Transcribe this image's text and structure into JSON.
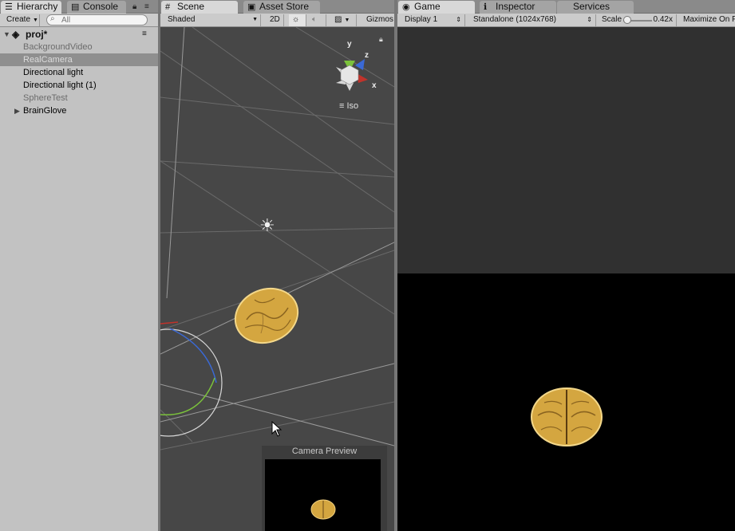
{
  "hierarchy": {
    "tabs": [
      {
        "label": "Hierarchy",
        "icon": "list-icon"
      },
      {
        "label": "Console",
        "icon": "console-icon"
      }
    ],
    "create_label": "Create",
    "search_placeholder": "All",
    "scene_name": "proj*",
    "items": [
      {
        "label": "BackgroundVideo",
        "state": "disabled"
      },
      {
        "label": "RealCamera",
        "state": "selected"
      },
      {
        "label": "Directional light",
        "state": "normal"
      },
      {
        "label": "Directional light (1)",
        "state": "normal"
      },
      {
        "label": "SphereTest",
        "state": "disabled"
      },
      {
        "label": "BrainGlove",
        "state": "collapsed"
      }
    ]
  },
  "scene": {
    "tabs": [
      {
        "label": "Scene",
        "icon": "grid-icon"
      },
      {
        "label": "Asset Store",
        "icon": "store-icon"
      }
    ],
    "toolbar": {
      "shading": "Shaded",
      "mode_2d": "2D",
      "gizmos": "Gizmos"
    },
    "gizmo": {
      "y": "y",
      "z": "z",
      "x": "x",
      "projection": "Iso"
    },
    "camera_preview_title": "Camera Preview"
  },
  "game": {
    "tabs": [
      {
        "label": "Game",
        "icon": "game-icon"
      },
      {
        "label": "Inspector",
        "icon": "info-icon"
      },
      {
        "label": "Services",
        "icon": ""
      }
    ],
    "toolbar": {
      "display": "Display 1",
      "resolution": "Standalone (1024x768)",
      "scale_label": "Scale",
      "scale_value": "0.42x",
      "maximize": "Maximize On P"
    }
  },
  "colors": {
    "brain": "#e0b84a",
    "brain_dark": "#8a6420",
    "gizmo_x": "#c0332b",
    "gizmo_y": "#7bc23b",
    "gizmo_z": "#3a69d6",
    "selection": "#8f8f8f"
  }
}
